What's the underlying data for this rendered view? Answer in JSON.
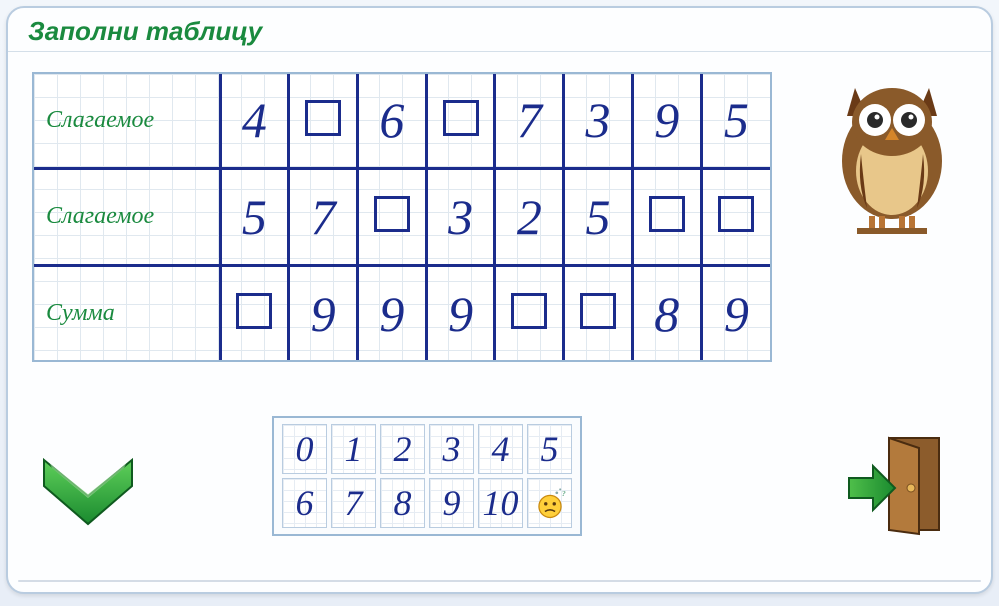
{
  "title": "Заполни таблицу",
  "row_labels": [
    "Слагаемое",
    "Слагаемое",
    "Сумма"
  ],
  "table": [
    [
      "4",
      "",
      "6",
      "",
      "7",
      "3",
      "9",
      "5"
    ],
    [
      "5",
      "7",
      "",
      "3",
      "2",
      "5",
      "",
      ""
    ],
    [
      "",
      "9",
      "9",
      "9",
      "",
      "",
      "8",
      "9"
    ]
  ],
  "palette_rows": [
    [
      "0",
      "1",
      "2",
      "3",
      "4",
      "5"
    ],
    [
      "6",
      "7",
      "8",
      "9",
      "10",
      "?"
    ]
  ],
  "icons": {
    "owl": "owl-mascot",
    "check": "green-check",
    "exit": "door-exit",
    "hint": "thinking-face"
  }
}
